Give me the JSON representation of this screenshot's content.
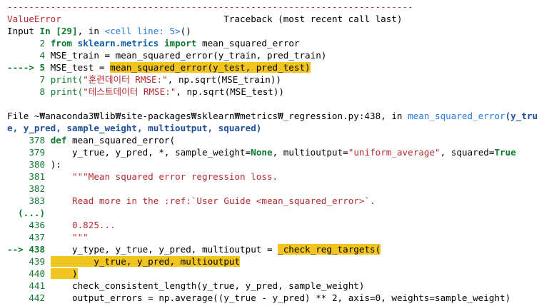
{
  "dashes": "---------------------------------------------------------------------------",
  "error_name": "ValueError",
  "traceback_title": "Traceback (most recent call last)",
  "input": {
    "prefix": "Input ",
    "in_label": "In [29]",
    "sep": ", in ",
    "cell": "<cell line: 5>",
    "parens": "()"
  },
  "input_lines": [
    {
      "num": "2",
      "a": "from",
      "b": " sklearn.metrics",
      "c": " import",
      "d": " mean_squared_error"
    },
    {
      "num": "4",
      "text": "MSE_train = mean_squared_error(y_train, pred_train)"
    },
    {
      "arrow": "----> 5",
      "pre": "MSE_test = ",
      "hl": "mean_squared_error(y_test, pred_test)"
    },
    {
      "num": "7",
      "fn": "print(",
      "str": "\"훈련데이터 RMSE:\"",
      "rest": ", np.sqrt(MSE_train))"
    },
    {
      "num": "8",
      "fn": "print(",
      "str": "\"테스트데이터 RMSE:\"",
      "rest": ", np.sqrt(MSE_test))"
    }
  ],
  "file": {
    "path": "File ~₩anaconda3₩lib₩site-packages₩sklearn₩metrics₩_regression.py:438",
    "sep": ", in ",
    "func": "mean_squared_error",
    "args1": "(y_tru",
    "args2": "e, y_pred, sample_weight, multioutput, squared)"
  },
  "code_lines": [
    {
      "num": "378",
      "kw": "def",
      "rest": " mean_squared_error("
    },
    {
      "num": "379",
      "text": "    y_true, y_pred, *, sample_weight=",
      "kw2": "None",
      "text2": ", multioutput=",
      "str": "\"uniform_average\"",
      "text3": ", squared=",
      "kw3": "True"
    },
    {
      "num": "380",
      "text": "):"
    },
    {
      "num": "381",
      "str": "    \"\"\"Mean squared error regression loss."
    },
    {
      "num": "382",
      "str": ""
    },
    {
      "num": "383",
      "str": "    Read more in the :ref:`User Guide <mean_squared_error>`."
    },
    {
      "ellipsis": "(...)"
    },
    {
      "num": "436",
      "str": "    0.825..."
    },
    {
      "num": "437",
      "str": "    \"\"\""
    },
    {
      "arrow": "--> 438",
      "pre": "    y_type, y_true, y_pred, multioutput = ",
      "hl": "_check_reg_targets("
    },
    {
      "num": "439",
      "hl": "        y_true, y_pred, multioutput"
    },
    {
      "num": "440",
      "hl": "    )"
    },
    {
      "num": "441",
      "text": "    check_consistent_length(y_true, y_pred, sample_weight)"
    },
    {
      "num": "442",
      "text": "    output_errors = np.average((y_true - y_pred) ** 2, axis=0, weights=sample_weight)"
    }
  ]
}
